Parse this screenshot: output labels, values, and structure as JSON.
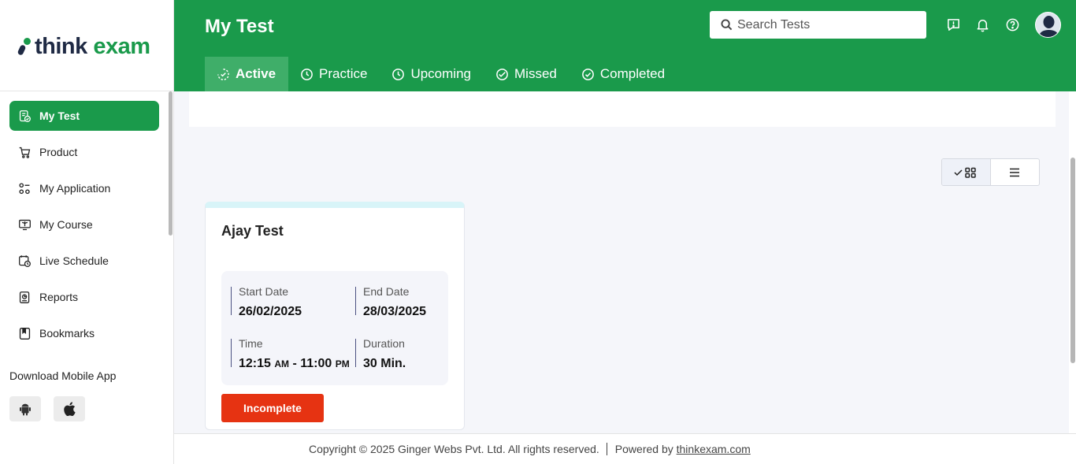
{
  "brand": {
    "name_part1": "think",
    "name_part2": "exam"
  },
  "sidebar": {
    "items": [
      {
        "label": "My Test",
        "icon": "test-icon",
        "active": true
      },
      {
        "label": "Product",
        "icon": "cart-icon"
      },
      {
        "label": "My Application",
        "icon": "apps-icon"
      },
      {
        "label": "My Course",
        "icon": "course-icon"
      },
      {
        "label": "Live Schedule",
        "icon": "schedule-icon"
      },
      {
        "label": "Reports",
        "icon": "reports-icon"
      },
      {
        "label": "Bookmarks",
        "icon": "bookmark-icon"
      }
    ],
    "download_title": "Download Mobile App",
    "stores": [
      "android-icon",
      "apple-icon"
    ]
  },
  "header": {
    "title": "My Test",
    "search_placeholder": "Search Tests",
    "icons": [
      "feedback-icon",
      "bell-icon",
      "help-icon",
      "avatar"
    ],
    "tabs": [
      {
        "label": "Active",
        "active": true
      },
      {
        "label": "Practice"
      },
      {
        "label": "Upcoming"
      },
      {
        "label": "Missed"
      },
      {
        "label": "Completed"
      }
    ]
  },
  "view_toggle": {
    "selected": "grid"
  },
  "test_card": {
    "title": "Ajay Test",
    "start_label": "Start Date",
    "start_value": "26/02/2025",
    "end_label": "End Date",
    "end_value": "28/03/2025",
    "time_label": "Time",
    "time_start": "12:15",
    "time_start_ampm": "AM",
    "time_sep": " - ",
    "time_end": "11:00",
    "time_end_ampm": "PM",
    "duration_label": "Duration",
    "duration_value": "30 Min.",
    "status": "Incomplete"
  },
  "footer": {
    "copyright": "Copyright © 2025 Ginger Webs Pvt. Ltd. All rights reserved.",
    "powered_by": "Powered by",
    "link": "thinkexam.com"
  },
  "colors": {
    "primary": "#1a9a4b",
    "tab_active": "#3fae69",
    "danger": "#e63312",
    "card_top": "#d8f4f8"
  }
}
